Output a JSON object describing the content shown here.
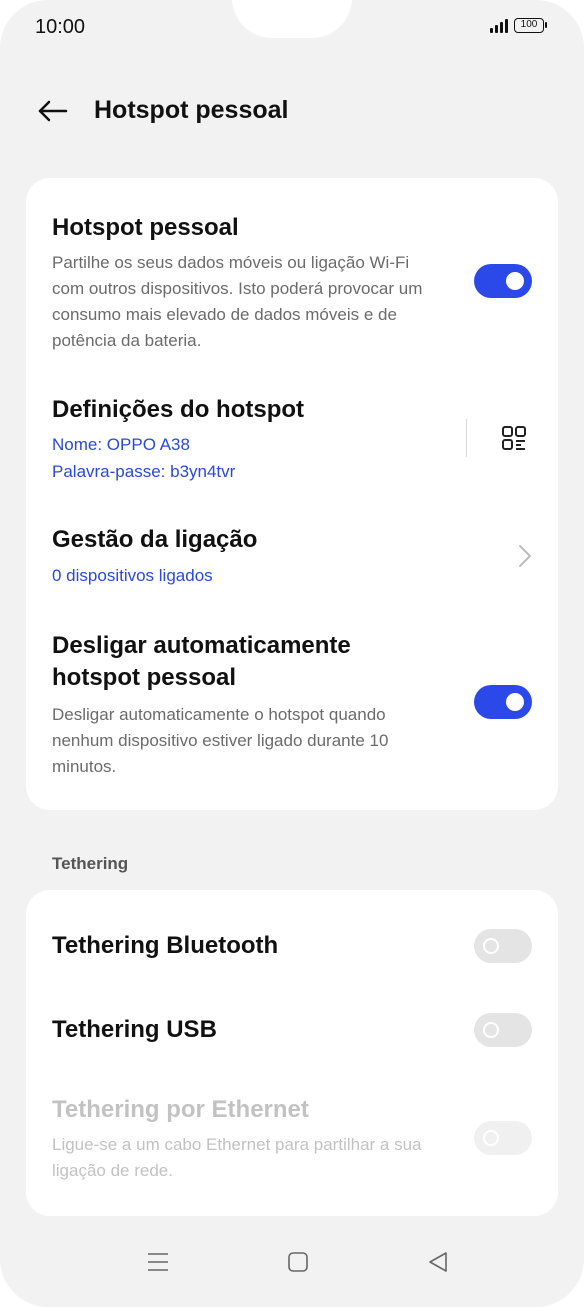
{
  "status_bar": {
    "time": "10:00",
    "battery": "100",
    "signal_icon": "signal-icon"
  },
  "header": {
    "back_icon": "back-arrow-icon",
    "title": "Hotspot pessoal"
  },
  "hotspot": {
    "title": "Hotspot pessoal",
    "description": "Partilhe os seus dados móveis ou ligação Wi-Fi com outros dispositivos. Isto poderá provocar um consumo mais elevado de dados móveis e de potência da bateria.",
    "enabled": true
  },
  "hotspot_settings": {
    "title": "Definições do hotspot",
    "name_line": "Nome: OPPO A38",
    "password_line": "Palavra-passe: b3yn4tvr",
    "qr_icon": "qr-code-icon"
  },
  "connection_management": {
    "title": "Gestão da ligação",
    "subtitle": "0 dispositivos ligados",
    "chevron_icon": "chevron-right-icon"
  },
  "auto_off": {
    "title_line1": "Desligar automaticamente",
    "title_line2": "hotspot pessoal",
    "description": "Desligar automaticamente o hotspot quando nenhum dispositivo estiver ligado durante 10 minutos.",
    "enabled": true
  },
  "tethering": {
    "section_label": "Tethering",
    "bluetooth": {
      "title": "Tethering Bluetooth",
      "enabled": false
    },
    "usb": {
      "title": "Tethering USB",
      "enabled": false
    },
    "ethernet": {
      "title": "Tethering por Ethernet",
      "description": "Ligue-se a um cabo Ethernet para partilhar a sua ligação de rede.",
      "enabled": false,
      "disabled": true
    }
  },
  "nav_bar": {
    "menu_icon": "menu-icon",
    "home_icon": "home-icon",
    "back_icon": "nav-back-icon"
  },
  "colors": {
    "accent": "#2b49e8",
    "link": "#2b49d6",
    "background": "#f2f2f2",
    "card": "#ffffff"
  }
}
